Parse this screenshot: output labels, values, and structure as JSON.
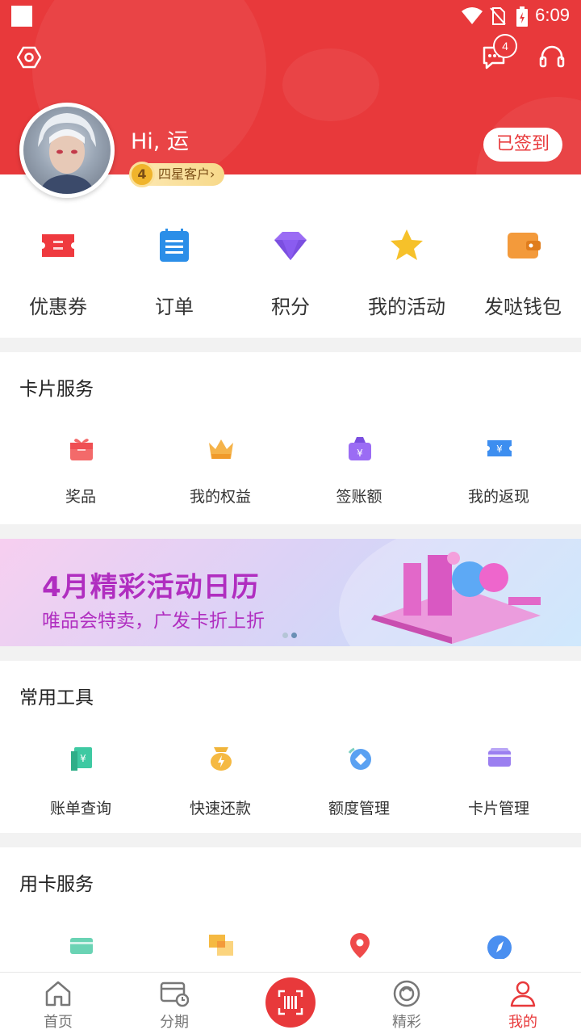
{
  "status_bar": {
    "time": "6:09"
  },
  "header": {
    "message_badge": "4",
    "greeting": "Hi, 运",
    "level_number": "4",
    "level_label": "四星客户",
    "level_arrow": "›",
    "signed_label": "已签到",
    "colors": {
      "brand": "#e8393b"
    },
    "icons": [
      "settings-hexagon-icon",
      "message-icon",
      "customer-service-headset-icon"
    ]
  },
  "quick": [
    {
      "label": "优惠券",
      "icon": "coupon-icon",
      "color": "#e8393b"
    },
    {
      "label": "订单",
      "icon": "order-list-icon",
      "color": "#2b8ee8"
    },
    {
      "label": "积分",
      "icon": "diamond-icon",
      "color": "#8a5cf0"
    },
    {
      "label": "我的活动",
      "icon": "star-icon",
      "color": "#f6c12a"
    },
    {
      "label": "发哒钱包",
      "icon": "wallet-icon",
      "color": "#f39a3b"
    }
  ],
  "card_service": {
    "title": "卡片服务",
    "items": [
      {
        "label": "奖品",
        "icon": "gift-icon"
      },
      {
        "label": "我的权益",
        "icon": "crown-icon"
      },
      {
        "label": "签账额",
        "icon": "money-bag-icon"
      },
      {
        "label": "我的返现",
        "icon": "cashback-ticket-icon"
      }
    ]
  },
  "banner": {
    "title": "4月精彩活动日历",
    "subtitle": "唯品会特卖，广发卡折上折"
  },
  "tools": {
    "title": "常用工具",
    "items": [
      {
        "label": "账单查询",
        "icon": "bill-icon"
      },
      {
        "label": "快速还款",
        "icon": "quick-repay-icon"
      },
      {
        "label": "额度管理",
        "icon": "credit-limit-icon"
      },
      {
        "label": "卡片管理",
        "icon": "card-manage-icon"
      }
    ]
  },
  "card_use": {
    "title": "用卡服务",
    "items": [
      {
        "icon": "card-icon"
      },
      {
        "icon": "overlap-squares-icon"
      },
      {
        "icon": "location-pin-icon"
      },
      {
        "icon": "compass-icon"
      }
    ]
  },
  "tabbar": [
    {
      "label": "首页",
      "icon": "home-icon"
    },
    {
      "label": "分期",
      "icon": "installment-icon"
    },
    {
      "label": "",
      "icon": "scan-barcode-icon"
    },
    {
      "label": "精彩",
      "icon": "discover-icon"
    },
    {
      "label": "我的",
      "icon": "profile-icon",
      "active": true
    }
  ]
}
